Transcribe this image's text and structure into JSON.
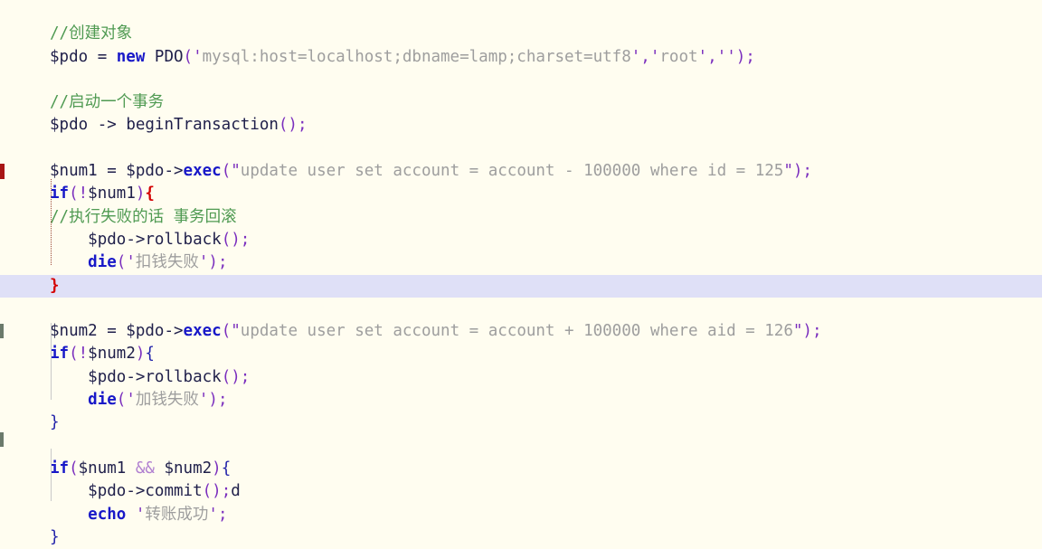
{
  "editor": {
    "language": "PHP",
    "background_color": "#fffdf0",
    "current_line_highlight_color": "#dfe0f7",
    "comment_color": "#4f9a52",
    "keyword_color": "#1818c8",
    "string_color": "#9e9e9e",
    "punctuation_color": "#7b2fbe",
    "error_brace_color": "#d40000",
    "variable_color": "#1f1f4a"
  },
  "lines": [
    {
      "num": 1,
      "text": "",
      "type": "blank"
    },
    {
      "num": 2,
      "text": "//创建对象",
      "type": "comment"
    },
    {
      "num": 3,
      "text": "$pdo = new PDO('mysql:host=localhost;dbname=lamp;charset=utf8','root','');",
      "type": "code"
    },
    {
      "num": 4,
      "text": "",
      "type": "blank"
    },
    {
      "num": 5,
      "text": "//启动一个事务",
      "type": "comment"
    },
    {
      "num": 6,
      "text": "$pdo -> beginTransaction();",
      "type": "code"
    },
    {
      "num": 7,
      "text": "",
      "type": "blank"
    },
    {
      "num": 8,
      "text": "$num1 = $pdo->exec(\"update user set account = account - 100000 where id = 125\");",
      "type": "code"
    },
    {
      "num": 9,
      "text": "if(!$num1){",
      "type": "code"
    },
    {
      "num": 10,
      "text": "    //执行失败的话 事务回滚",
      "type": "comment"
    },
    {
      "num": 11,
      "text": "    $pdo->rollback();",
      "type": "code"
    },
    {
      "num": 12,
      "text": "    die('扣钱失败');",
      "type": "code"
    },
    {
      "num": 13,
      "text": "}",
      "type": "code",
      "current": true
    },
    {
      "num": 14,
      "text": "",
      "type": "blank"
    },
    {
      "num": 15,
      "text": "$num2 = $pdo->exec(\"update user set account = account + 100000 where aid = 126\");",
      "type": "code"
    },
    {
      "num": 16,
      "text": "if(!$num2){",
      "type": "code"
    },
    {
      "num": 17,
      "text": "    $pdo->rollback();",
      "type": "code"
    },
    {
      "num": 18,
      "text": "    die('加钱失败');",
      "type": "code"
    },
    {
      "num": 19,
      "text": "}",
      "type": "code"
    },
    {
      "num": 20,
      "text": "",
      "type": "blank"
    },
    {
      "num": 21,
      "text": "if($num1 && $num2){",
      "type": "code"
    },
    {
      "num": 22,
      "text": "    $pdo->commit();d",
      "type": "code"
    },
    {
      "num": 23,
      "text": "    echo '转账成功';",
      "type": "code"
    },
    {
      "num": 24,
      "text": "}",
      "type": "code"
    }
  ],
  "tokens": {
    "l2_comment": "//创建对象",
    "l3_var": "$pdo",
    "l3_eq": " = ",
    "l3_new": "new",
    "l3_class": " PDO",
    "l3_paren_open": "(",
    "l3_q1": "'",
    "l3_dsn": "mysql:host=localhost;dbname=lamp;charset=utf8",
    "l3_q2": "'",
    "l3_comma1": ",",
    "l3_q3": "'",
    "l3_user": "root",
    "l3_q4": "'",
    "l3_comma2": ",",
    "l3_q5": "'",
    "l3_pass": "",
    "l3_q6": "'",
    "l3_paren_close": ")",
    "l3_semi": ";",
    "l5_comment": "//启动一个事务",
    "l6_var": "$pdo",
    "l6_arrow": " -> ",
    "l6_method": "beginTransaction",
    "l6_parens": "()",
    "l6_semi": ";",
    "l8_var": "$num1",
    "l8_eq": " = ",
    "l8_obj": "$pdo",
    "l8_arrow": "->",
    "l8_method": "exec",
    "l8_paren_open": "(",
    "l8_dq1": "\"",
    "l8_sql": "update user set account = account - 100000 where id = 125",
    "l8_dq2": "\"",
    "l8_paren_close": ")",
    "l8_semi": ";",
    "l9_if": "if",
    "l9_paren_open": "(",
    "l9_not": "!",
    "l9_var": "$num1",
    "l9_paren_close": ")",
    "l9_brace": "{",
    "l10_comment": "//执行失败的话 事务回滚",
    "l11_var": "$pdo",
    "l11_arrow": "->",
    "l11_method": "rollback",
    "l11_parens": "()",
    "l11_semi": ";",
    "l12_fn": "die",
    "l12_paren_open": "(",
    "l12_q1": "'",
    "l12_msg": "扣钱失败",
    "l12_q2": "'",
    "l12_paren_close": ")",
    "l12_semi": ";",
    "l13_brace": "}",
    "l15_var": "$num2",
    "l15_eq": " = ",
    "l15_obj": "$pdo",
    "l15_arrow": "->",
    "l15_method": "exec",
    "l15_paren_open": "(",
    "l15_dq1": "\"",
    "l15_sql": "update user set account = account + 100000 where aid = 126",
    "l15_dq2": "\"",
    "l15_paren_close": ")",
    "l15_semi": ";",
    "l16_if": "if",
    "l16_paren_open": "(",
    "l16_not": "!",
    "l16_var": "$num2",
    "l16_paren_close": ")",
    "l16_brace": "{",
    "l17_var": "$pdo",
    "l17_arrow": "->",
    "l17_method": "rollback",
    "l17_parens": "()",
    "l17_semi": ";",
    "l18_fn": "die",
    "l18_paren_open": "(",
    "l18_q1": "'",
    "l18_msg": "加钱失败",
    "l18_q2": "'",
    "l18_paren_close": ")",
    "l18_semi": ";",
    "l19_brace": "}",
    "l21_if": "if",
    "l21_paren_open": "(",
    "l21_var1": "$num1",
    "l21_and": " && ",
    "l21_var2": "$num2",
    "l21_paren_close": ")",
    "l21_brace": "{",
    "l22_var": "$pdo",
    "l22_arrow": "->",
    "l22_method": "commit",
    "l22_parens": "()",
    "l22_semi": ";",
    "l22_stray": "d",
    "l23_echo": "echo",
    "l23_space": " ",
    "l23_q1": "'",
    "l23_msg": "转账成功",
    "l23_q2": "'",
    "l23_semi": ";",
    "l24_brace": "}"
  }
}
